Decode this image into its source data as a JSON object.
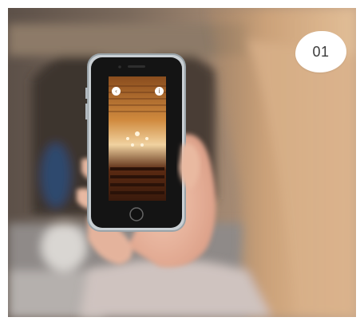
{
  "badge": {
    "text": "01"
  },
  "icons": {
    "back": "chevron-left-icon",
    "info": "info-icon"
  },
  "colors": {
    "badge_bg": "#ffffff",
    "badge_text": "#3a3a3a"
  }
}
